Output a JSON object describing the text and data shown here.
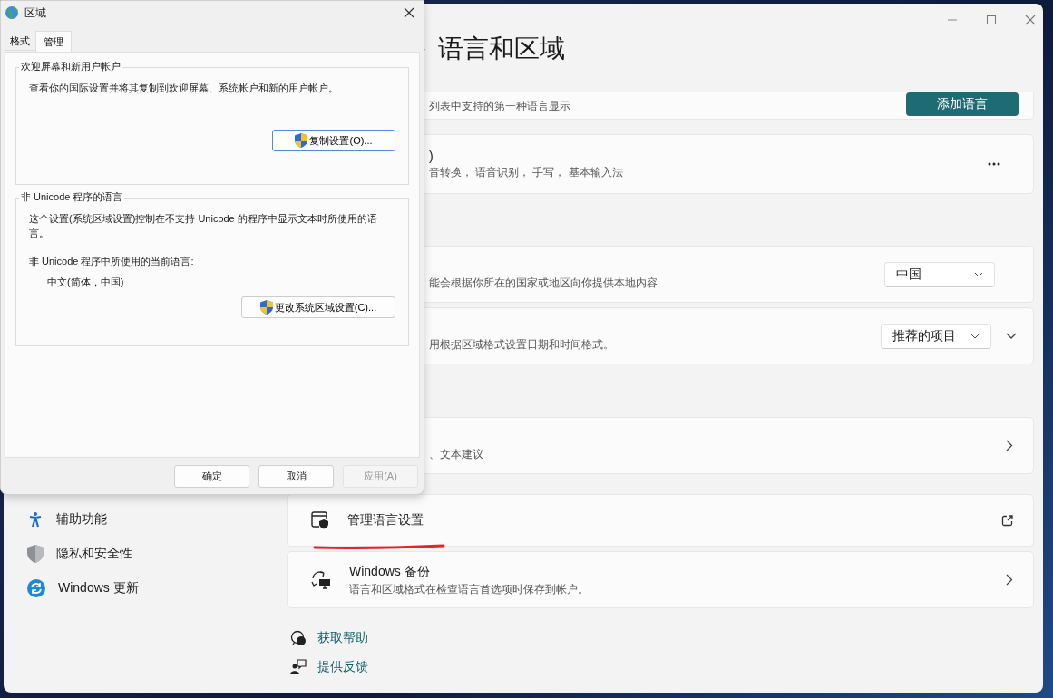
{
  "settings": {
    "sidebar": [
      {
        "label": "辅助功能",
        "kind": "accessibility"
      },
      {
        "label": "隐私和安全性",
        "kind": "privacy"
      },
      {
        "label": "Windows 更新",
        "kind": "update"
      }
    ],
    "page_title": "语言和区域",
    "cards": [
      {
        "kind": "partial",
        "subtitle": "列表中支持的第一种语言显示",
        "control": {
          "kind": "button",
          "label": "添加语言"
        }
      },
      {
        "kind": "partial",
        "title": ")",
        "subtitle": "音转换， 语音识别， 手写， 基本输入法",
        "control": {
          "kind": "more"
        }
      },
      {
        "kind": "partial",
        "subtitle": "能会根据你所在的国家或地区向你提供本地内容",
        "control": {
          "kind": "dropdown",
          "value": "中国"
        }
      },
      {
        "kind": "partial",
        "subtitle": "用根据区域格式设置日期和时间格式。",
        "control": {
          "kind": "dropdown",
          "value": "推荐的项目",
          "expandable": true
        }
      },
      {
        "kind": "partial",
        "subtitle": "、文本建议",
        "control": {
          "kind": "chevron"
        }
      },
      {
        "kind": "manage",
        "title": "管理语言设置",
        "underlined": true,
        "control": {
          "kind": "external"
        }
      },
      {
        "kind": "backup",
        "title": "Windows 备份",
        "subtitle": "语言和区域格式在检查语言首选项时保存到帐户。",
        "control": {
          "kind": "chevron"
        }
      }
    ],
    "links": [
      {
        "label": "获取帮助",
        "kind": "help"
      },
      {
        "label": "提供反馈",
        "kind": "feedback"
      }
    ]
  },
  "dialog": {
    "title": "区域",
    "tabs": [
      {
        "label": "格式",
        "selected": false
      },
      {
        "label": "管理",
        "selected": true
      }
    ],
    "groups": [
      {
        "title": "欢迎屏幕和新用户帐户",
        "text": "查看你的国际设置并将其复制到欢迎屏幕、系统帐户和新的用户帐户。",
        "button": "复制设置(O)..."
      },
      {
        "title": "非 Unicode 程序的语言",
        "text": "这个设置(系统区域设置)控制在不支持 Unicode 的程序中显示文本时所使用的语言。",
        "label": "非 Unicode 程序中所使用的当前语言:",
        "value": "中文(简体，中国)",
        "button": "更改系统区域设置(C)..."
      }
    ],
    "buttons": [
      {
        "label": "确定",
        "disabled": false
      },
      {
        "label": "取消",
        "disabled": false
      },
      {
        "label": "应用(A)",
        "disabled": true
      }
    ]
  }
}
